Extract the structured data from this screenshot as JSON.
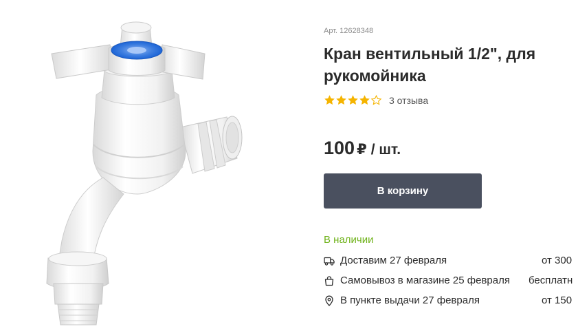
{
  "product": {
    "sku": "Арт. 12628348",
    "title": "Кран вентильный 1/2\", для рукомойника",
    "rating": {
      "value": 4,
      "max": 5,
      "reviews_label": "3 отзыва"
    },
    "price": {
      "value": "100",
      "currency": "₽",
      "unit": "/ шт."
    },
    "cart_button_label": "В корзину",
    "stock_status": "В наличии",
    "delivery": [
      {
        "icon": "truck-icon",
        "label": "Доставим 27 февраля",
        "cost": "от 300"
      },
      {
        "icon": "shopping-bag-icon",
        "label": "Самовывоз в магазине 25 февраля",
        "cost": "бесплатн"
      },
      {
        "icon": "location-pin-icon",
        "label": "В пункте выдачи 27 февраля",
        "cost": "от 150"
      }
    ]
  },
  "colors": {
    "button_bg": "#4a505f",
    "star": "#f5b400",
    "in_stock": "#6fb21a",
    "accent_blue": "#1c64d6"
  }
}
